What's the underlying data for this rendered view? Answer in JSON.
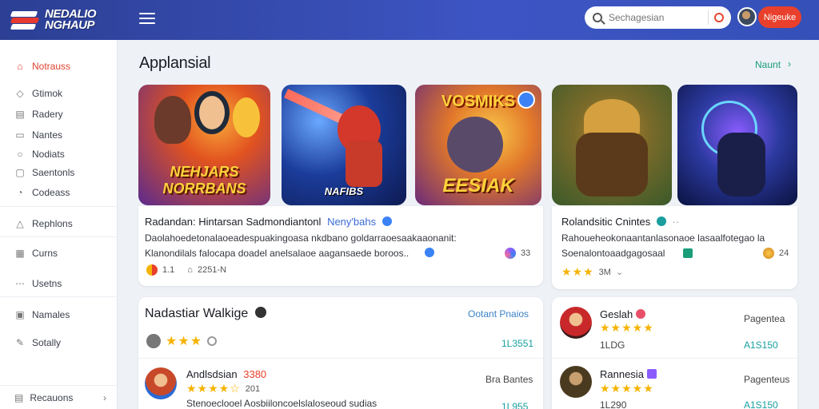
{
  "header": {
    "logo_line1": "NEDALIO",
    "logo_line2": "NGHAUP",
    "search_placeholder": "Sechagesian",
    "action_button": "Nigeuke"
  },
  "sidebar": {
    "items": [
      {
        "label": "Notrauss",
        "icon": "home-icon",
        "active": true
      },
      {
        "label": "Gtimok",
        "icon": "shield-icon"
      },
      {
        "label": "Radery",
        "icon": "grid-icon"
      },
      {
        "label": "Nantes",
        "icon": "chat-icon"
      },
      {
        "label": "Nodiats",
        "icon": "circle-icon"
      },
      {
        "label": "Saentonls",
        "icon": "bookmark-icon"
      },
      {
        "label": "Codeass",
        "icon": "clock-icon"
      },
      {
        "label": "Rephlons",
        "icon": "triangle-icon"
      },
      {
        "label": "Curns",
        "icon": "image-icon"
      },
      {
        "label": "Usetns",
        "icon": "dots-icon"
      },
      {
        "label": "Namales",
        "icon": "grid-small-icon"
      },
      {
        "label": "Sotally",
        "icon": "pencil-icon"
      }
    ],
    "footer": "Recauons"
  },
  "main": {
    "title": "Applansial",
    "see_all": "Naunt",
    "tiles": [
      {
        "banner": "NEHJARS NORRBANS",
        "colors": [
          "#e96a1f",
          "#5a2a8f"
        ]
      },
      {
        "banner": "NAFIBS",
        "colors": [
          "#1b3c9a",
          "#d4382a"
        ]
      },
      {
        "banner": "EESIAK",
        "top_banner": "VOSMIKS",
        "colors": [
          "#f2a51f",
          "#6a2a7a"
        ]
      },
      {
        "banner": "",
        "colors": [
          "#4f8a3a",
          "#c0892a"
        ]
      },
      {
        "banner": "",
        "colors": [
          "#1c2a8f",
          "#7a3cc8"
        ]
      }
    ],
    "featured": [
      {
        "title": "Radandan: Hintarsan Sadmondiantonl",
        "tag": "Neny'bahs",
        "desc1": "Daolahoedetonalaoeadespuakingoasa nkdbano goldarraoesaakaaonanit:",
        "desc2": "Klanondilals falocapa doadel anelsalaoe aagansaede boroos..",
        "count": "33",
        "meta1": "1.1",
        "meta2": "2251-N"
      },
      {
        "title": "Rolandsitic Cnintes",
        "tag": "",
        "desc1": "Rahoueheokonaantanlasonaoe lasaalfotegao la",
        "desc2": "Soenalontoaadgagosaal",
        "count": "24",
        "rating": "3M"
      }
    ],
    "list_left": {
      "title": "Nadastiar Walkige",
      "link": "Ootant Pnaios",
      "row1_value": "1L3551",
      "entry": {
        "name": "Andlsdsian",
        "price": "3380",
        "meta": "201",
        "right": "Bra Bantes",
        "desc": "Stenoeclooel Aosbiiloncoelslaloseoud sudias",
        "value": "1L955"
      }
    },
    "list_right": {
      "entries": [
        {
          "name": "Geslah",
          "label": "Pagentea",
          "sub": "1LDG",
          "value": "A1S150"
        },
        {
          "name": "Rannesia",
          "label": "Pagenteus",
          "sub": "1L290",
          "value": "A1S150"
        }
      ]
    }
  }
}
